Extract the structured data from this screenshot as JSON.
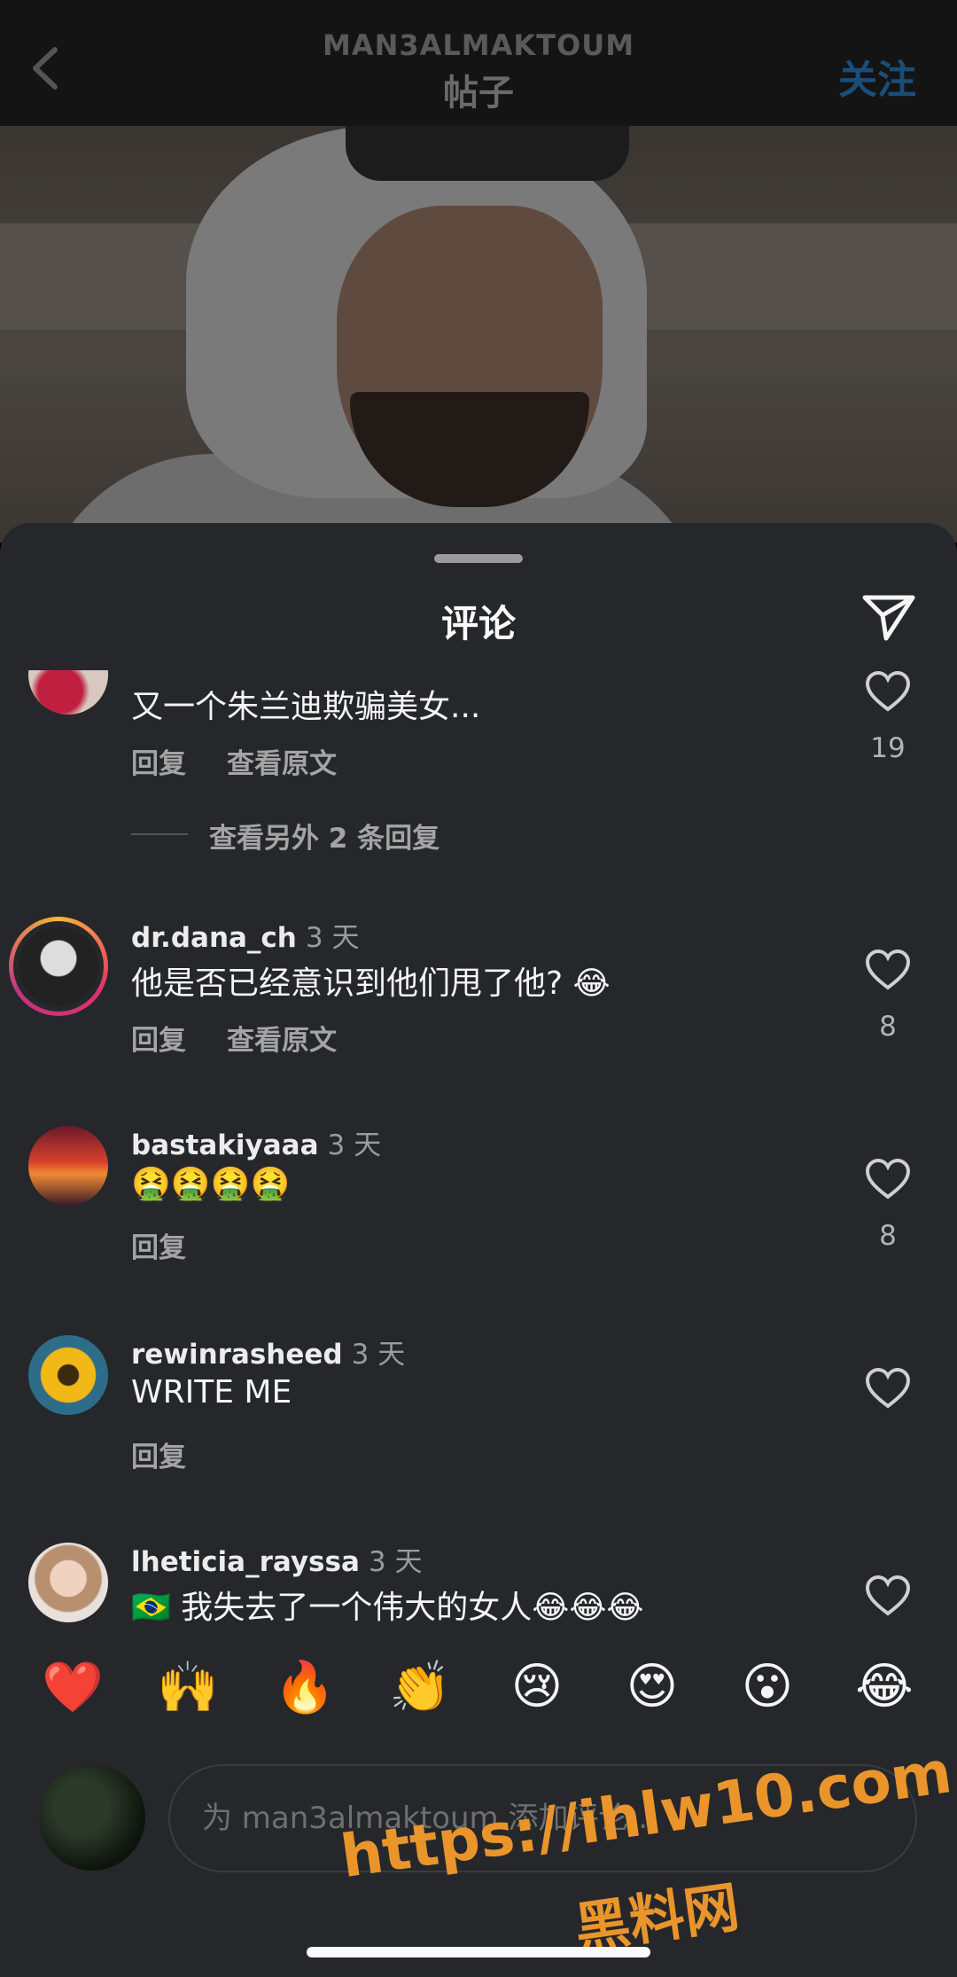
{
  "header": {
    "username": "MAN3ALMAKTOUM",
    "subtitle": "帖子",
    "follow_label": "关注"
  },
  "sheet": {
    "title": "评论"
  },
  "comments": [
    {
      "text": "又一个朱兰迪欺骗美女...",
      "reply_label": "回复",
      "translate_label": "查看原文",
      "likes": "19",
      "more_replies": "查看另外 2 条回复"
    },
    {
      "username": "dr.dana_ch",
      "time": "3 天",
      "text": "他是否已经意识到他们甩了他? 😂",
      "reply_label": "回复",
      "translate_label": "查看原文",
      "likes": "8"
    },
    {
      "username": "bastakiyaaa",
      "time": "3 天",
      "text": "🤮🤮🤮🤮",
      "reply_label": "回复",
      "likes": "8"
    },
    {
      "username": "rewinrasheed",
      "time": "3 天",
      "text": "WRITE ME",
      "reply_label": "回复"
    },
    {
      "username": "lheticia_rayssa",
      "time": "3 天",
      "text": "🇧🇷 我失去了一个伟大的女人😂😂😂"
    }
  ],
  "emoji_bar": [
    "❤️",
    "🙌",
    "🔥",
    "👏",
    "😢",
    "😍",
    "😮",
    "😂"
  ],
  "compose": {
    "placeholder": "为 man3almaktoum 添加评论..."
  },
  "watermark": {
    "url": "https://ihlw10.com",
    "name": "黑料网"
  },
  "colors": {
    "accent_blue": "#1a4e7a",
    "sheet_bg": "#26272b",
    "watermark_orange": "#e9952b"
  }
}
